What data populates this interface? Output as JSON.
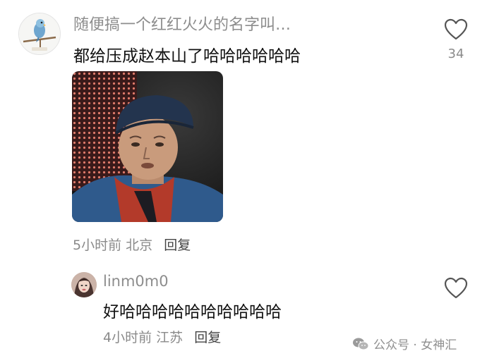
{
  "comments": [
    {
      "username": "随便搞一个红红火火的名字叫…",
      "text": "都给压成赵本山了哈哈哈哈哈哈",
      "time": "5小时前",
      "location": "北京",
      "reply_label": "回复",
      "like_count": "34",
      "avatar_icon": "parrot-avatar",
      "image_icon": "meme-man-in-cap-photo"
    },
    {
      "username": "linm0m0",
      "text": "好哈哈哈哈哈哈哈哈哈哈",
      "time": "4小时前",
      "location": "江苏",
      "reply_label": "回复",
      "avatar_icon": "woman-avatar"
    }
  ],
  "watermark": {
    "text": "公众号 · 女神汇",
    "icon": "wechat-icon"
  },
  "colors": {
    "username": "#8d8d8d",
    "body_text": "#111111",
    "meta": "#8a8a8a",
    "heart_stroke": "#555555"
  }
}
